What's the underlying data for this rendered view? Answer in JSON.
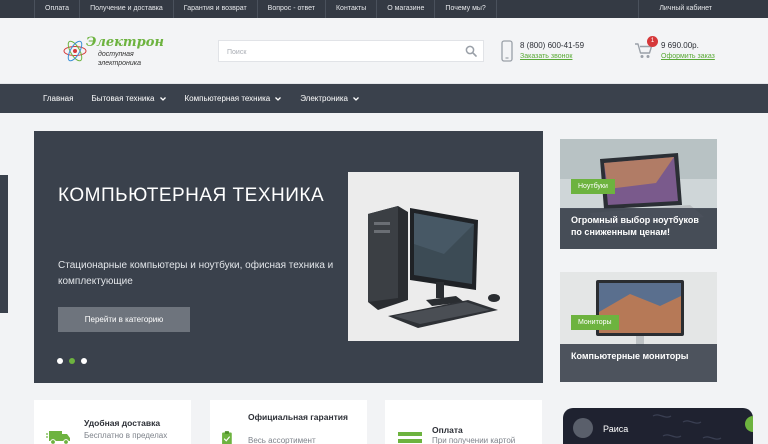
{
  "topbar": {
    "links": [
      "Оплата",
      "Получение и доставка",
      "Гарантия и возврат",
      "Вопрос - ответ",
      "Контакты",
      "О магазине",
      "Почему мы?"
    ],
    "account": "Личный кабинет"
  },
  "header": {
    "logo": {
      "name": "Электрон",
      "tagline1": "доступная",
      "tagline2": "электроника"
    },
    "search": {
      "placeholder": "Поиск",
      "icon": "search-icon"
    },
    "phone": {
      "number": "8 (800) 600-41-59",
      "callback": "Заказать звонок",
      "icon": "phone-icon"
    },
    "cart": {
      "count": "1",
      "sum": "9 690.00р.",
      "checkout": "Оформить заказ",
      "icon": "cart-icon"
    }
  },
  "mainnav": {
    "items": [
      {
        "label": "Главная"
      },
      {
        "label": "Бытовая техника"
      },
      {
        "label": "Компьютерная техника"
      },
      {
        "label": "Электроника"
      }
    ]
  },
  "slider": {
    "title": "КОМПЬЮТЕРНАЯ ТЕХНИКА",
    "description": "Стационарные компьютеры и ноутбуки, офисная техника и комплектующие",
    "button": "Перейти в категорию",
    "slides_total": 3,
    "active_slide": 2
  },
  "promos": [
    {
      "tag": "Ноутбуки",
      "title": "Огромный выбор ноутбуков по сниженным ценам!"
    },
    {
      "tag": "Мониторы",
      "title": "Компьютерные мониторы"
    }
  ],
  "features": [
    {
      "title": "Удобная доставка",
      "subtitle": "Бесплатно в пределах"
    },
    {
      "title": "Официальная гарантия",
      "subtitle": "Весь ассортимент"
    },
    {
      "title": "Оплата",
      "subtitle": "При получении картой"
    }
  ],
  "chat": {
    "name": "Раиса"
  },
  "colors": {
    "accent": "#6db33f",
    "dark": "#3a414c",
    "topbar": "#343a44",
    "badge": "#d6383a"
  }
}
